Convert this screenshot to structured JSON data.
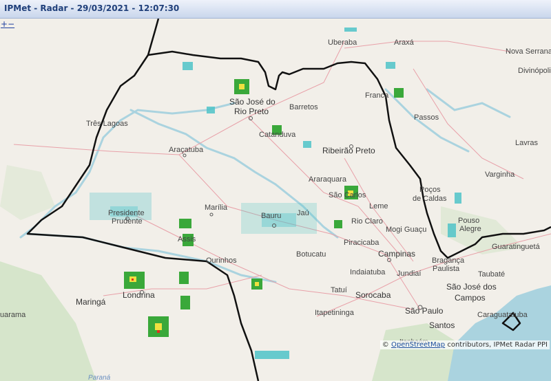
{
  "title": "IPMet - Radar - 29/03/2021 - 12:07:30",
  "zoom": {
    "plus": "+",
    "minus": "−"
  },
  "attribution": {
    "copyright": "©",
    "link": "OpenStreetMap",
    "rest": " contributors, IPMet Radar PPI"
  },
  "colors": {
    "land": "#f2efe9",
    "water": "#aad3df",
    "border": "#111111",
    "road": "#e8a0a8",
    "radar_light": "#4ec3c8",
    "radar_green": "#3aa83a",
    "radar_yellow": "#f0e040",
    "radar_red": "#e03020"
  },
  "cities": [
    {
      "name": "Uberaba"
    },
    {
      "name": "Araxá"
    },
    {
      "name": "Nova Serrana"
    },
    {
      "name": "Divinópolis"
    },
    {
      "name": "São José do"
    },
    {
      "name": "Rio Preto"
    },
    {
      "name": "Barretos"
    },
    {
      "name": "Franca"
    },
    {
      "name": "Passos"
    },
    {
      "name": "Três Lagoas"
    },
    {
      "name": "Catanduva"
    },
    {
      "name": "Ribeirão Preto"
    },
    {
      "name": "Araçatuba"
    },
    {
      "name": "Lavras"
    },
    {
      "name": "Varginha"
    },
    {
      "name": "Araraquara"
    },
    {
      "name": "São Carlos"
    },
    {
      "name": "Poços"
    },
    {
      "name": "de Caldas"
    },
    {
      "name": "Marília"
    },
    {
      "name": "Bauru"
    },
    {
      "name": "Jaú"
    },
    {
      "name": "Leme"
    },
    {
      "name": "Presidente"
    },
    {
      "name": "Prudente"
    },
    {
      "name": "Rio Claro"
    },
    {
      "name": "Mogi Guaçu"
    },
    {
      "name": "Pouso"
    },
    {
      "name": "Alegre"
    },
    {
      "name": "Assis"
    },
    {
      "name": "Piracicaba"
    },
    {
      "name": "Guaratinguetá"
    },
    {
      "name": "Ourinhos"
    },
    {
      "name": "Botucatu"
    },
    {
      "name": "Campinas"
    },
    {
      "name": "Bragança"
    },
    {
      "name": "Paulista"
    },
    {
      "name": "Taubaté"
    },
    {
      "name": "Indaiatuba"
    },
    {
      "name": "Jundiaí"
    },
    {
      "name": "São José dos"
    },
    {
      "name": "Campos"
    },
    {
      "name": "Londrina"
    },
    {
      "name": "Tatuí"
    },
    {
      "name": "Sorocaba"
    },
    {
      "name": "Maringá"
    },
    {
      "name": "Itapetininga"
    },
    {
      "name": "São Paulo"
    },
    {
      "name": "Caraguatatuba"
    },
    {
      "name": "Santos"
    },
    {
      "name": "uarama"
    },
    {
      "name": "Itanhaém"
    },
    {
      "name": "Paraná"
    }
  ]
}
